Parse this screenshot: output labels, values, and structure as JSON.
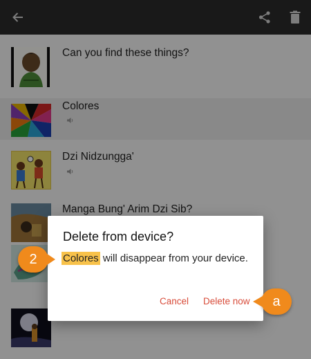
{
  "toolbar": {
    "back_icon": "arrow-left-icon",
    "share_icon": "share-icon",
    "delete_icon": "trash-icon"
  },
  "books": [
    {
      "title": "Can you find these things?"
    },
    {
      "title": "Colores",
      "has_audio": true,
      "selected": true
    },
    {
      "title": "Dzi Nidzungga'",
      "has_audio": true
    },
    {
      "title": "Manga Bung' Arim Dzi Sib?"
    }
  ],
  "dialog": {
    "title": "Delete from device?",
    "book_name": "Colores",
    "message_rest": " will disappear from your device.",
    "cancel_label": "Cancel",
    "delete_label": "Delete now"
  },
  "callouts": {
    "step_number": "2",
    "step_letter": "a"
  },
  "colors": {
    "toolbar": "#2b2b2b",
    "accent_button": "#d84c3a",
    "highlight": "#f8c24a",
    "callout": "#f08a1c"
  }
}
